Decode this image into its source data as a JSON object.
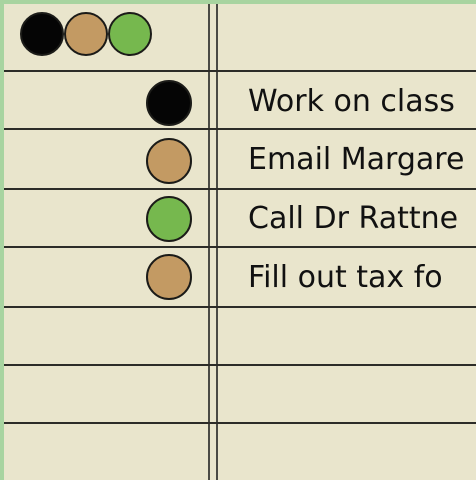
{
  "header": {
    "legend_dots": [
      {
        "name": "black",
        "color": "#050505"
      },
      {
        "name": "tan",
        "color": "#c39a63"
      },
      {
        "name": "green",
        "color": "#76b84e"
      }
    ]
  },
  "tasks": [
    {
      "label": "Work on class",
      "status_color": "#050505",
      "status_icon": "black-circle-icon"
    },
    {
      "label": "Email Margare",
      "status_color": "#c39a63",
      "status_icon": "tan-circle-icon"
    },
    {
      "label": "Call Dr Rattne",
      "status_color": "#76b84e",
      "status_icon": "green-circle-icon"
    },
    {
      "label": "Fill out tax fo",
      "status_color": "#c39a63",
      "status_icon": "tan-circle-icon"
    }
  ]
}
